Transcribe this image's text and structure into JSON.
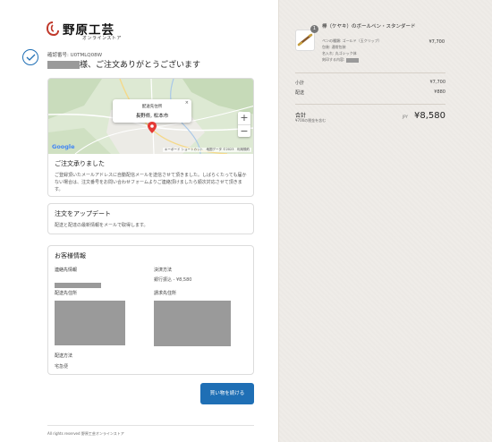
{
  "brand": {
    "name": "野原工芸",
    "subtitle": "オンラインストア",
    "accent": "#c0392b"
  },
  "order": {
    "number_label": "確認番号: U0TMLQ08W",
    "thanks": "様、ご注文ありがとうございます"
  },
  "map": {
    "popup_label": "配送先住所",
    "popup_place": "長野県, 松本市",
    "zoom_in": "+",
    "zoom_out": "−",
    "google": "Google",
    "footer": "キーボード ショートカット　地図データ ©2023　利用規約"
  },
  "confirm": {
    "title": "ご注文承りました",
    "body": "ご登録頂いたメールアドレスに自動配信メールを送信させて頂きました。しばらくたっても届かない場合は、注文番号をお問い合わせフォームよりご連絡頂けましたら順次対応させて頂きます。"
  },
  "update": {
    "title": "注文をアップデート",
    "body": "配送と配達の最新情報をメールで取得します。"
  },
  "customer": {
    "title": "お客様情報",
    "contact_label": "連絡先情報",
    "payment_label": "決済方法",
    "payment_value": "銀行振込 - ¥8,580",
    "shipping_label": "配送先住所",
    "billing_label": "請求先住所",
    "method_label": "配送方法",
    "method_value": "宅急便"
  },
  "continue_button": "買い物を続ける",
  "footer": "All rights reserved 野原工芸オンラインストア",
  "summary": {
    "item": {
      "qty": "1",
      "name": "欅（ケヤキ）のボールペン・スタンダード",
      "opt1": "ペンの種類: ゴールド（玉クリップ）",
      "opt2": "包装: 通常包装",
      "opt3": "名入れ: 丸ゴシック体",
      "opt4": "刻印する内容:",
      "price": "¥7,700"
    },
    "subtotal_label": "小計",
    "subtotal": "¥7,700",
    "shipping_label": "配送",
    "shipping": "¥880",
    "total_label": "合計",
    "tax_note": "¥700の税金を含む",
    "currency": "JPY",
    "total": "¥8,580"
  },
  "colors": {
    "primary": "#1f6fb5",
    "sidebar_bg": "#efece8",
    "redaction": "#9a9a9a"
  }
}
